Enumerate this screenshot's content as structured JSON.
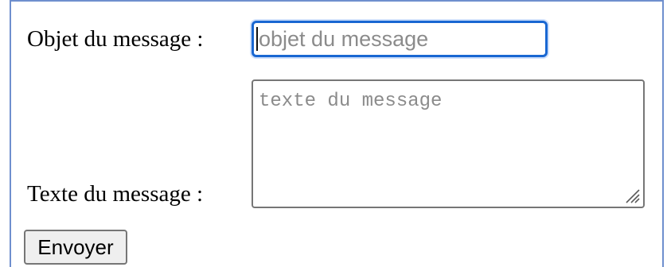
{
  "form": {
    "subject_label": "Objet du message :",
    "subject_placeholder": "objet du message",
    "message_label": "Texte du message :",
    "message_placeholder": "texte du message",
    "send_label": "Envoyer"
  },
  "colors": {
    "frame_border": "#6f8fce",
    "focus_border": "#1967d2",
    "focus_ring": "#cfe0fb",
    "placeholder_text": "#8b8b8b",
    "control_border": "#767676",
    "button_background": "#efefef"
  },
  "icons": {
    "text_caret": "text-caret-icon",
    "resize_grip": "resize-grip-icon"
  }
}
